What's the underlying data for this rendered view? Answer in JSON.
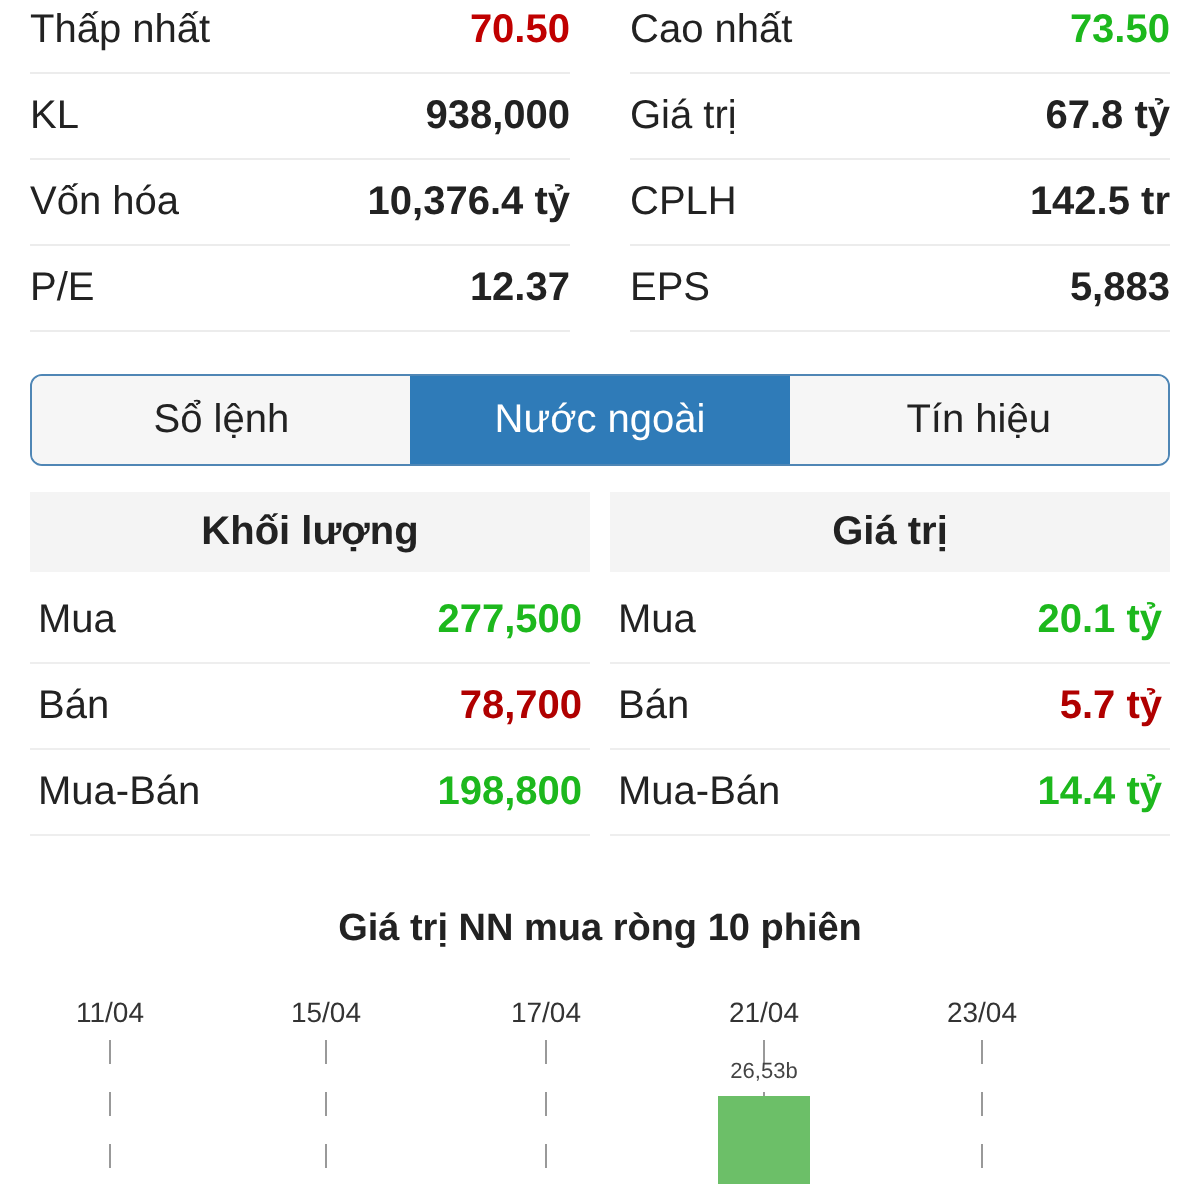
{
  "stats": [
    {
      "label": "Thấp nhất",
      "value": "70.50",
      "color": "#c00000"
    },
    {
      "label": "Cao nhất",
      "value": "73.50",
      "color": "#1db81d"
    },
    {
      "label": "KL",
      "value": "938,000",
      "color": "#222222"
    },
    {
      "label": "Giá trị",
      "value": "67.8 tỷ",
      "color": "#222222"
    },
    {
      "label": "Vốn hóa",
      "value": "10,376.4 tỷ",
      "color": "#222222"
    },
    {
      "label": "CPLH",
      "value": "142.5 tr",
      "color": "#222222"
    },
    {
      "label": "P/E",
      "value": "12.37",
      "color": "#222222"
    },
    {
      "label": "EPS",
      "value": "5,883",
      "color": "#222222"
    }
  ],
  "tabs": [
    {
      "label": "Sổ lệnh",
      "selected": false
    },
    {
      "label": "Nước ngoài",
      "selected": true
    },
    {
      "label": "Tín hiệu",
      "selected": false
    }
  ],
  "foreign_tables": [
    {
      "heading": "Khối lượng",
      "rows": [
        {
          "label": "Mua",
          "value": "277,500",
          "color": "#1db81d"
        },
        {
          "label": "Bán",
          "value": "78,700",
          "color": "#b00000"
        },
        {
          "label": "Mua-Bán",
          "value": "198,800",
          "color": "#1db81d"
        }
      ]
    },
    {
      "heading": "Giá trị",
      "rows": [
        {
          "label": "Mua",
          "value": "20.1 tỷ",
          "color": "#1db81d"
        },
        {
          "label": "Bán",
          "value": "5.7 tỷ",
          "color": "#b00000"
        },
        {
          "label": "Mua-Bán",
          "value": "14.4 tỷ",
          "color": "#1db81d"
        }
      ]
    }
  ],
  "chart": {
    "title": "Giá trị NN mua ròng 10 phiên",
    "date_labels": [
      "11/04",
      "15/04",
      "17/04",
      "21/04",
      "23/04"
    ],
    "bar_label": "26,53b"
  }
}
